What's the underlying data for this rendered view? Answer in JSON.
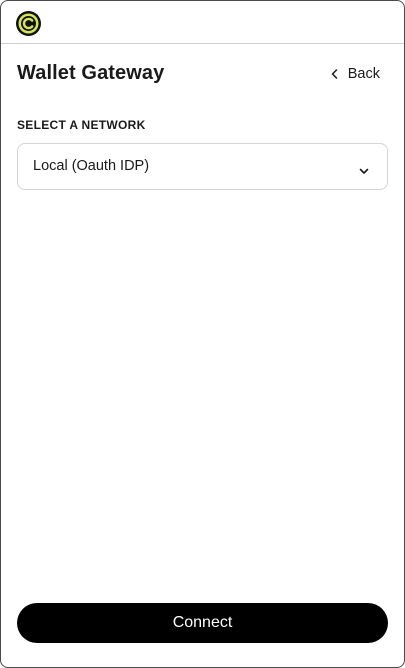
{
  "header": {
    "logo_icon": "c-logo-icon",
    "title": "Wallet Gateway",
    "back_label": "Back",
    "back_icon": "chevron-left-icon"
  },
  "network": {
    "label": "SELECT A NETWORK",
    "selected": "Local (Oauth IDP)",
    "dropdown_icon": "chevron-down-icon"
  },
  "actions": {
    "connect_label": "Connect"
  },
  "colors": {
    "logo_ring": "#d7e35a",
    "logo_bg": "#111111",
    "primary_button": "#000000",
    "border": "#d4d4d4"
  }
}
